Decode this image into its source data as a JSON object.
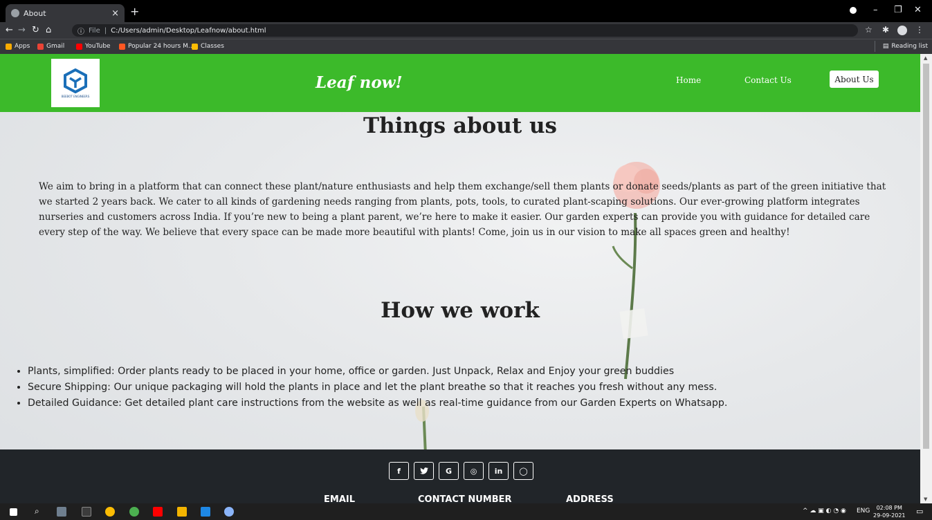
{
  "browser": {
    "tab_title": "About",
    "tab_close": "×",
    "new_tab": "+",
    "url_prefix": "File",
    "url": "C:/Users/admin/Desktop/Leafnow/about.html",
    "bookmarks": [
      "Apps",
      "Gmail",
      "YouTube",
      "Popular 24 hours M...",
      "Classes"
    ],
    "reading_list": "Reading list"
  },
  "header": {
    "logo_caption": "BEEBOT ENGINEERS",
    "site_title": "Leaf now!",
    "nav": {
      "home": "Home",
      "contact": "Contact Us",
      "about": "About Us"
    },
    "color": "#3cba2a"
  },
  "about": {
    "heading": "Things about us",
    "paragraph": "We aim to bring in a platform that can connect these plant/nature enthusiasts and help them exchange/sell them plants or donate seeds/plants as part of the green initiative that we started 2 years back. We cater to all kinds of gardening needs ranging from plants, pots, tools, to curated plant-scaping solutions. Our ever-growing platform integrates nurseries and customers across India. If you’re new to being a plant parent, we’re here to make it easier. Our garden experts can provide you with guidance for detailed care every step of the way. We believe that every space can be made more beautiful with plants! Come, join us in our vision to make all spaces green and healthy!"
  },
  "work": {
    "heading": "How we work",
    "items": [
      "Plants, simplified: Order plants ready to be placed in your home, office or garden. Just Unpack, Relax and Enjoy your green buddies",
      "Secure Shipping: Our unique packaging will hold the plants in place and let the plant breathe so that it reaches you fresh without any mess.",
      "Detailed Guidance: Get detailed plant care instructions from the website as well as real-time guidance from our Garden Experts on Whatsapp."
    ]
  },
  "footer": {
    "socials": [
      {
        "icon": "facebook-icon",
        "glyph": "f"
      },
      {
        "icon": "twitter-icon",
        "glyph": "t"
      },
      {
        "icon": "google-icon",
        "glyph": "G"
      },
      {
        "icon": "instagram-icon",
        "glyph": "◎"
      },
      {
        "icon": "linkedin-icon",
        "glyph": "in"
      },
      {
        "icon": "github-icon",
        "glyph": "◯"
      }
    ],
    "labels": {
      "email": "EMAIL",
      "contact": "CONTACT NUMBER",
      "address": "ADDRESS"
    },
    "color": "#212529"
  },
  "taskbar": {
    "language": "ENG",
    "time": "02:08 PM",
    "date": "29-09-2021"
  }
}
